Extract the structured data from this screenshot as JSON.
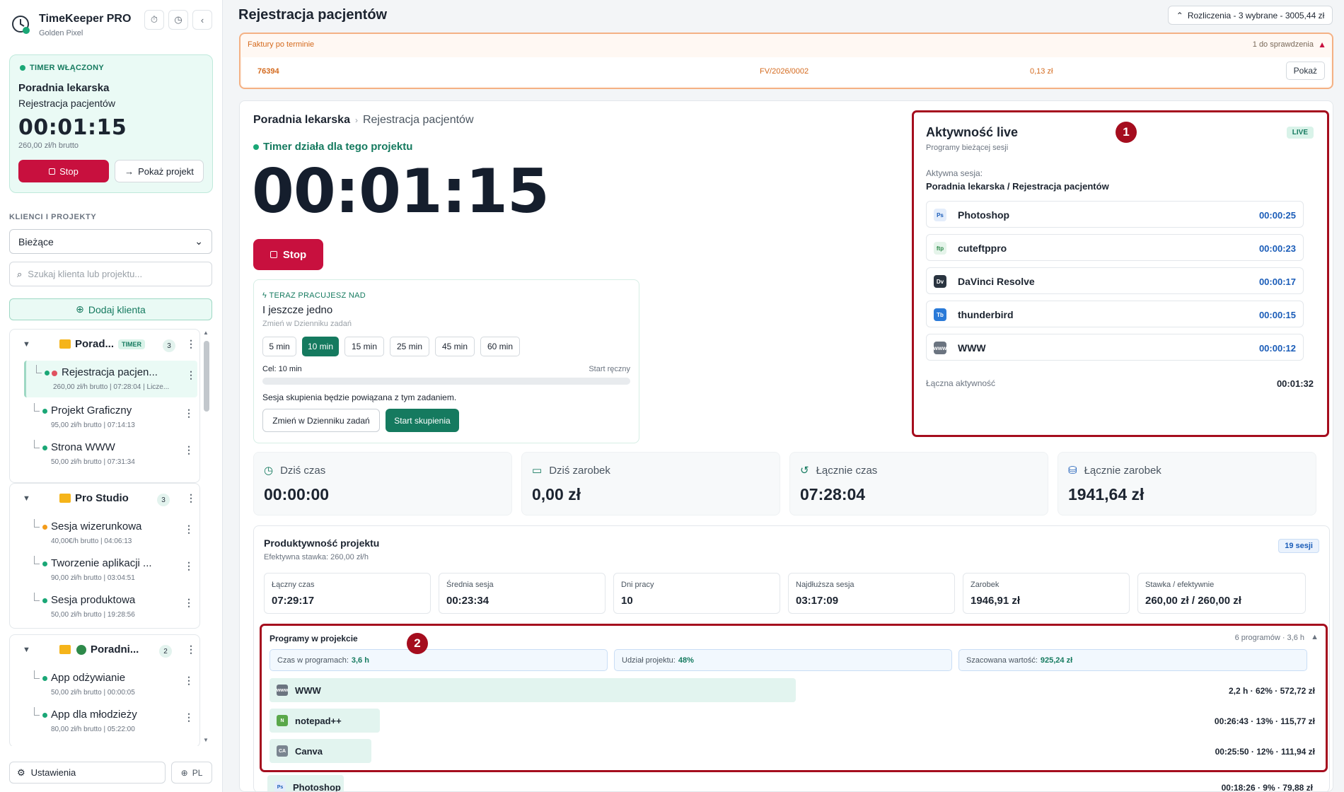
{
  "app": {
    "name": "TimeKeeper PRO",
    "subtitle": "Golden Pixel"
  },
  "timer_card": {
    "status": "TIMER WŁĄCZONY",
    "client": "Poradnia lekarska",
    "project": "Rejestracja pacjentów",
    "time": "00:01:15",
    "rate": "260,00 zł/h brutto",
    "stop_label": "Stop",
    "show_label": "Pokaż projekt"
  },
  "sidebar": {
    "section_label": "KLIENCI I PROJEKTY",
    "filter_value": "Bieżące",
    "search_placeholder": "Szukaj klienta lub projektu...",
    "add_client_label": "Dodaj klienta",
    "groups": [
      {
        "name": "Porad...",
        "badge": "TIMER",
        "count": "3",
        "projects": [
          {
            "name": "Rejestracja pacjen...",
            "info": "260,00 zł/h brutto | 07:28:04 | Licze..."
          },
          {
            "name": "Projekt Graficzny",
            "info": "95,00 zł/h brutto | 07:14:13"
          },
          {
            "name": "Strona WWW",
            "info": "50,00 zł/h brutto | 07:31:34"
          }
        ]
      },
      {
        "name": "Pro Studio",
        "count": "3",
        "projects": [
          {
            "name": "Sesja wizerunkowa",
            "info": "40,00€/h brutto | 04:06:13"
          },
          {
            "name": "Tworzenie aplikacji ...",
            "info": "90,00 zł/h brutto | 03:04:51"
          },
          {
            "name": "Sesja produktowa",
            "info": "50,00 zł/h brutto | 19:28:56"
          }
        ]
      },
      {
        "name": "Poradni...",
        "count": "2",
        "projects": [
          {
            "name": "App odżywianie",
            "info": "50,00 zł/h brutto | 00:00:05"
          },
          {
            "name": "App dla młodzieży",
            "info": "80,00 zł/h brutto | 05:22:00"
          }
        ]
      }
    ],
    "settings_label": "Ustawienia",
    "lang": "PL"
  },
  "header": {
    "title": "Rejestracja pacjentów",
    "billing": "Rozliczenia - 3 wybrane - 3005,44 zł"
  },
  "overdue": {
    "title": "Faktury po terminie",
    "review": "1 do sprawdzenia",
    "row": {
      "id": "76394",
      "invoice": "FV/2026/0002",
      "amount": "0,13 zł",
      "show": "Pokaż"
    }
  },
  "breadcrumb": {
    "client": "Poradnia lekarska",
    "project": "Rejestracja pacjentów"
  },
  "running_label": "Timer działa dla tego projektu",
  "big_time": "00:01:15",
  "big_stop_label": "Stop",
  "focus": {
    "label": "TERAZ PRACUJESZ NAD",
    "task": "I jeszcze jedno",
    "change_link": "Zmień w Dzienniku zadań",
    "durations": [
      "5 min",
      "10 min",
      "15 min",
      "25 min",
      "45 min",
      "60 min"
    ],
    "goal": "Cel: 10 min",
    "manual": "Start ręczny",
    "note": "Sesja skupienia będzie powiązana z tym zadaniem.",
    "change_button": "Zmień w Dzienniku zadań",
    "start_button": "Start skupienia"
  },
  "live": {
    "title": "Aktywność live",
    "subtitle": "Programy bieżącej sesji",
    "badge": "LIVE",
    "active_label": "Aktywna sesja:",
    "active_value": "Poradnia lekarska / Rejestracja pacjentów",
    "apps": [
      {
        "name": "Photoshop",
        "time": "00:00:25",
        "icon": "Ps",
        "color": "#1a5cb8",
        "bg": "#e3edfb"
      },
      {
        "name": "cuteftppro",
        "time": "00:00:23",
        "icon": "ftp",
        "color": "#2e8a4a",
        "bg": "#e5f4ea"
      },
      {
        "name": "DaVinci Resolve",
        "time": "00:00:17",
        "icon": "Dv",
        "color": "#ffffff",
        "bg": "#2a3440"
      },
      {
        "name": "thunderbird",
        "time": "00:00:15",
        "icon": "Tb",
        "color": "#ffffff",
        "bg": "#2a7ad8"
      },
      {
        "name": "WWW",
        "time": "00:00:12",
        "icon": "www",
        "color": "#ffffff",
        "bg": "#6b7480"
      }
    ],
    "total_label": "Łączna aktywność",
    "total_value": "00:01:32"
  },
  "markers": [
    "1",
    "2"
  ],
  "stats": [
    {
      "label": "Dziś czas",
      "value": "00:00:00"
    },
    {
      "label": "Dziś zarobek",
      "value": "0,00 zł"
    },
    {
      "label": "Łącznie czas",
      "value": "07:28:04"
    },
    {
      "label": "Łącznie zarobek",
      "value": "1941,64 zł"
    }
  ],
  "productivity": {
    "title": "Produktywność projektu",
    "subtitle": "Efektywna stawka: 260,00 zł/h",
    "sessions": "19 sesji",
    "metrics": [
      {
        "label": "Łączny czas",
        "value": "07:29:17"
      },
      {
        "label": "Średnia sesja",
        "value": "00:23:34"
      },
      {
        "label": "Dni pracy",
        "value": "10"
      },
      {
        "label": "Najdłuższa sesja",
        "value": "03:17:09"
      },
      {
        "label": "Zarobek",
        "value": "1946,91 zł"
      },
      {
        "label": "Stawka / efektywnie",
        "value": "260,00 zł / 260,00 zł"
      }
    ]
  },
  "programs": {
    "title": "Programy w projekcie",
    "count": "6 programów · 3,6 h",
    "summary": [
      {
        "label": "Czas w programach:",
        "value": "3,6 h"
      },
      {
        "label": "Udział projektu:",
        "value": "48%"
      },
      {
        "label": "Szacowana wartość:",
        "value": "925,24 zł"
      }
    ],
    "rows": [
      {
        "name": "WWW",
        "value": "2,2 h · 62% · 572,72 zł",
        "share": 62,
        "icon": "www",
        "color": "#ffffff",
        "bg": "#6b7480"
      },
      {
        "name": "notepad++",
        "value": "00:26:43 · 13% · 115,77 zł",
        "share": 13,
        "icon": "N",
        "color": "#ffffff",
        "bg": "#5aa84a"
      },
      {
        "name": "Canva",
        "value": "00:25:50 · 12% · 111,94 zł",
        "share": 12,
        "icon": "CA",
        "color": "#ffffff",
        "bg": "#7a8590"
      },
      {
        "name": "Photoshop",
        "value": "00:18:26 · 9% · 79,88 zł",
        "share": 9,
        "icon": "Ps",
        "color": "#1a5cb8",
        "bg": "#e3edfb"
      }
    ]
  }
}
